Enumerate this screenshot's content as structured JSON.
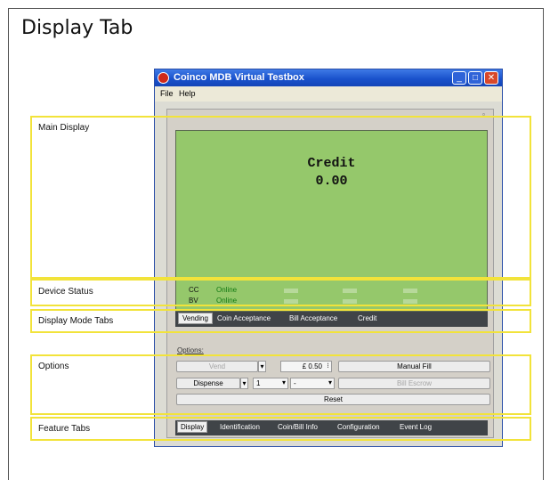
{
  "slide": {
    "title": "Display Tab"
  },
  "window": {
    "title": "Coinco MDB Virtual Testbox",
    "controls": {
      "minimize": "_",
      "maximize": "□",
      "close": "✕"
    },
    "menu": [
      "File",
      "Help"
    ]
  },
  "display": {
    "credit_label": "Credit",
    "credit_value": "0.00",
    "devices": [
      {
        "name": "CC",
        "state": "Online"
      },
      {
        "name": "BV",
        "state": "Online"
      }
    ]
  },
  "mode_tabs": [
    {
      "label": "Vending",
      "active": true
    },
    {
      "label": "Coin Acceptance",
      "active": false
    },
    {
      "label": "Bill Acceptance",
      "active": false
    },
    {
      "label": "Credit",
      "active": false
    }
  ],
  "options": {
    "label": "Options:",
    "vend_button": "Vend",
    "price_value": "£  0.50",
    "manual_fill_button": "Manual Fill",
    "dispense_select": "Dispense",
    "quantity_select": "1",
    "denomination_select": "-",
    "bill_escrow_button": "Bill Escrow",
    "reset_button": "Reset"
  },
  "feature_tabs": [
    {
      "label": "Display",
      "active": true
    },
    {
      "label": "Identification",
      "active": false
    },
    {
      "label": "Coin/Bill Info",
      "active": false
    },
    {
      "label": "Configuration",
      "active": false
    },
    {
      "label": "Event Log",
      "active": false
    }
  ],
  "callouts": {
    "main_display": "Main Display",
    "device_status": "Device Status",
    "display_mode_tabs": "Display Mode Tabs",
    "options": "Options",
    "feature_tabs": "Feature Tabs"
  },
  "colors": {
    "display_bg": "#95c86b",
    "online": "#127a12",
    "tab_bar": "#404448",
    "callout_border": "#f2e33a",
    "title_bar": "#1a52cc"
  }
}
